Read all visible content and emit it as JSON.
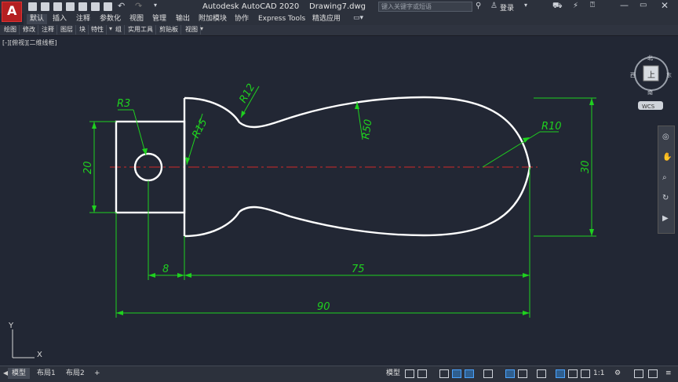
{
  "app": {
    "title": "Autodesk AutoCAD 2020",
    "file": "Drawing7.dwg",
    "logo_letter": "A"
  },
  "search": {
    "placeholder": "键入关键字或短语"
  },
  "user": {
    "login": "登录"
  },
  "tabs": [
    "默认",
    "插入",
    "注释",
    "参数化",
    "视图",
    "管理",
    "输出",
    "附加模块",
    "协作",
    "Express Tools",
    "精选应用"
  ],
  "ribbon": [
    "绘图",
    "修改",
    "注释",
    "图层",
    "块",
    "特性",
    "组",
    "实用工具",
    "剪贴板",
    "视图"
  ],
  "viewport_label": "[-][俯视][二维线框]",
  "viewcube": {
    "north": "北",
    "south": "南",
    "east": "东",
    "west": "西",
    "top": "上",
    "wcs": "WCS"
  },
  "drawing": {
    "dims": {
      "d20": "20",
      "d30": "30",
      "d8": "8",
      "d75": "75",
      "d90": "90"
    },
    "radii": {
      "r3": "R3",
      "r15": "R15",
      "r12": "R12",
      "r50": "R50",
      "r10": "R10"
    },
    "ucs": {
      "x": "X",
      "y": "Y"
    },
    "colors": {
      "object": "#ffffff",
      "dimension": "#1fd11f",
      "centerline": "#d02828",
      "background": "#222734"
    }
  },
  "layouts": [
    "模型",
    "布局1",
    "布局2",
    "+"
  ],
  "status": {
    "model": "模型",
    "scale": "1:1"
  }
}
